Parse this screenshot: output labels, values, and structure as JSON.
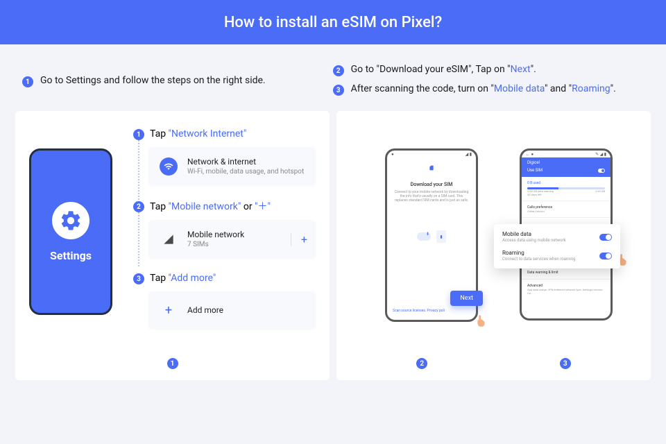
{
  "header": {
    "title": "How to install an eSIM on Pixel?"
  },
  "top_instructions": {
    "left": {
      "num": "1",
      "text": "Go to Settings and follow the steps on the right side."
    },
    "right": [
      {
        "num": "2",
        "pre": "Go to \"Download your eSIM\", Tap on \"",
        "hl": "Next",
        "post": "\"."
      },
      {
        "num": "3",
        "pre": "After scanning the code, turn on \"",
        "hl1": "Mobile data",
        "mid": "\" and \"",
        "hl2": "Roaming",
        "post": "\"."
      }
    ]
  },
  "left_panel": {
    "settings_label": "Settings",
    "step1": {
      "num": "1",
      "pre": "Tap ",
      "hl": "\"Network Internet\"",
      "card_title": "Network & internet",
      "card_sub": "Wi-Fi, mobile, data usage, and hotspot"
    },
    "step2": {
      "num": "2",
      "pre": "Tap ",
      "hl": "\"Mobile network\"",
      "mid": " or ",
      "hl2": "\"＋\"",
      "card_title": "Mobile network",
      "card_sub": "7 SIMs",
      "plus": "+"
    },
    "step3": {
      "num": "3",
      "pre": "Tap ",
      "hl": "\"Add more\"",
      "card_title": "Add more",
      "plus": "+"
    },
    "badge": "1"
  },
  "right_panel": {
    "phone2": {
      "title": "Download your SIM",
      "desc": "Connect to your mobile network by downloading the info that's usually on a SIM card. This replaces standard SIM cards and is just as safe.",
      "footer": "Scan source licenses. Privacy poli",
      "next": "Next"
    },
    "phone3": {
      "carrier": "Digicel",
      "use_sim": "Use SIM",
      "data_plan_line1": "0 B used",
      "data_plan_line2": "2.00 GB data warning",
      "data_plan_line3": "30 days left",
      "data_plan_right": "2.00 GB",
      "popup": {
        "mobile_data_title": "Mobile data",
        "mobile_data_sub": "Access data using mobile network",
        "roaming_title": "Roaming",
        "roaming_sub": "Connect to data services when roaming"
      },
      "calls_pref": "Calls preference",
      "calls_pref_sub": "China Unicom",
      "data_warn": "Data warning & limit",
      "advanced": "Advanced",
      "advanced_sub": "App data usage, VPN/tethered network type, Settings version, Ca..."
    },
    "badges": [
      "2",
      "3"
    ]
  }
}
